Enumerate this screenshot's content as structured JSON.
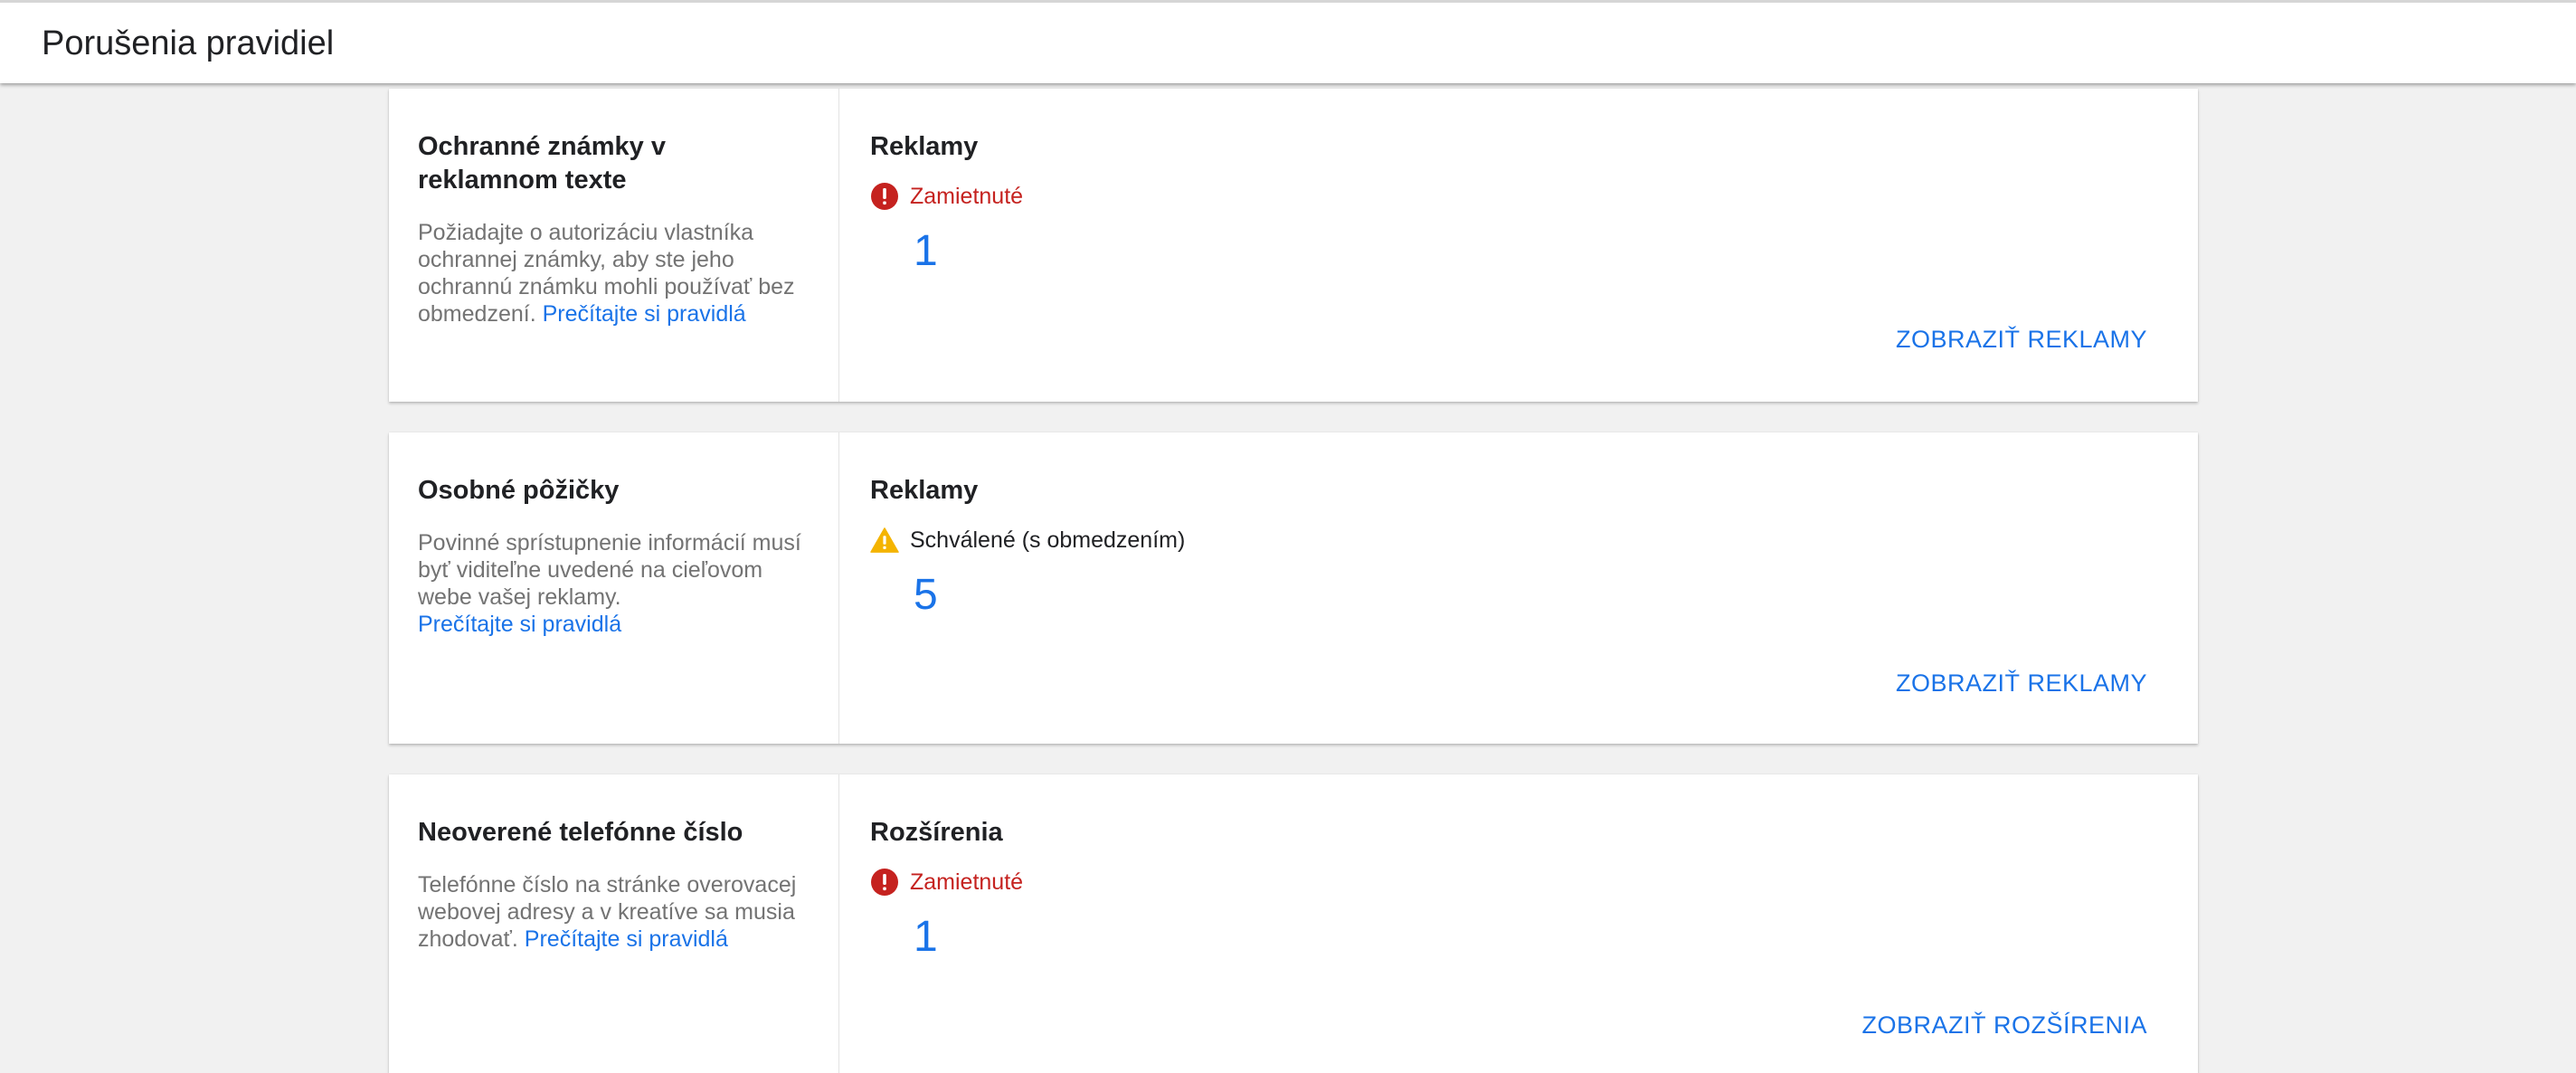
{
  "header": {
    "title": "Porušenia pravidiel"
  },
  "colors": {
    "rejected": "#c5221f",
    "warning": "#f4b400",
    "link": "#1a73e8"
  },
  "cards": [
    {
      "policy_title": "Ochranné známky v reklamnom texte",
      "policy_desc": "Požiadajte o autorizáciu vlastníka ochrannej známky, aby ste jeho ochrannú známku mohli používať bez obmedzení.",
      "policy_link": "Prečítajte si pravidlá",
      "section": "Reklamy",
      "status_icon": "error-icon",
      "status_label": "Zamietnuté",
      "count": "1",
      "action": "ZOBRAZIŤ REKLAMY"
    },
    {
      "policy_title": "Osobné pôžičky",
      "policy_desc": "Povinné sprístupnenie informácií musí byť viditeľne uvedené na cieľovom webe vašej reklamy.",
      "policy_link": "Prečítajte si pravidlá",
      "section": "Reklamy",
      "status_icon": "warning-icon",
      "status_label": "Schválené (s obmedzením)",
      "count": "5",
      "action": "ZOBRAZIŤ REKLAMY"
    },
    {
      "policy_title": "Neoverené telefónne číslo",
      "policy_desc": "Telefónne číslo na stránke overovacej webovej adresy a v kreatíve sa musia zhodovať.",
      "policy_link": "Prečítajte si pravidlá",
      "section": "Rozšírenia",
      "status_icon": "error-icon",
      "status_label": "Zamietnuté",
      "count": "1",
      "action": "ZOBRAZIŤ ROZŠÍRENIA"
    }
  ]
}
